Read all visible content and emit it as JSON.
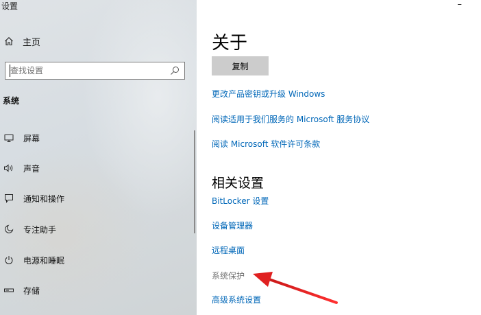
{
  "window": {
    "title": "设置",
    "minimize_glyph": "–"
  },
  "sidebar": {
    "home": {
      "icon": "home-icon",
      "label": "主页"
    },
    "search": {
      "placeholder": "查找设置",
      "icon": "search-icon"
    },
    "section": "系统",
    "items": [
      {
        "icon": "display-icon",
        "label": "屏幕"
      },
      {
        "icon": "speaker-icon",
        "label": "声音"
      },
      {
        "icon": "notification-icon",
        "label": "通知和操作"
      },
      {
        "icon": "focus-assist-icon",
        "label": "专注助手"
      },
      {
        "icon": "power-icon",
        "label": "电源和睡眠"
      },
      {
        "icon": "storage-icon",
        "label": "存储"
      }
    ]
  },
  "main": {
    "heading": "关于",
    "copy_button": "复制",
    "links": [
      "更改产品密钥或升级 Windows",
      "阅读适用于我们服务的 Microsoft 服务协议",
      "阅读 Microsoft 软件许可条款"
    ],
    "related_heading": "相关设置",
    "related": [
      "BitLocker 设置",
      "设备管理器",
      "远程桌面",
      "系统保护",
      "高级系统设置"
    ]
  },
  "colors": {
    "link": "#0067b8",
    "annotation_arrow": "#e02020",
    "button_bg": "#cccccc"
  }
}
